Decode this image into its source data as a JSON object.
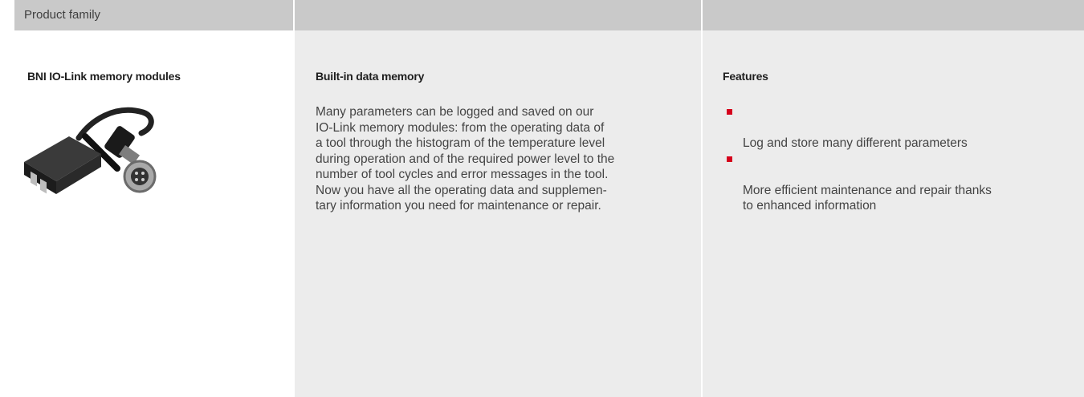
{
  "header": {
    "col1": "Product family",
    "col2": "",
    "col3": ""
  },
  "product": {
    "name": "BNI IO-Link memory modules",
    "image_icon": "io-link-memory-module-connector-image"
  },
  "description": {
    "title": "Built-in data memory",
    "text": "Many parameters can be logged and saved on our\nIO-Link memory modules: from the operating data of\na tool through the histogram of the temperature level\nduring operation and of the required power level to the\nnumber of tool cycles and error messages in the tool.\nNow you have all the operating data and supplemen-\ntary information you need for maintenance or repair."
  },
  "features": {
    "title": "Features",
    "items": [
      "Log and store many different parameters",
      "More efficient maintenance and repair thanks\nto enhanced information"
    ],
    "bullet_color": "#d5001c"
  }
}
